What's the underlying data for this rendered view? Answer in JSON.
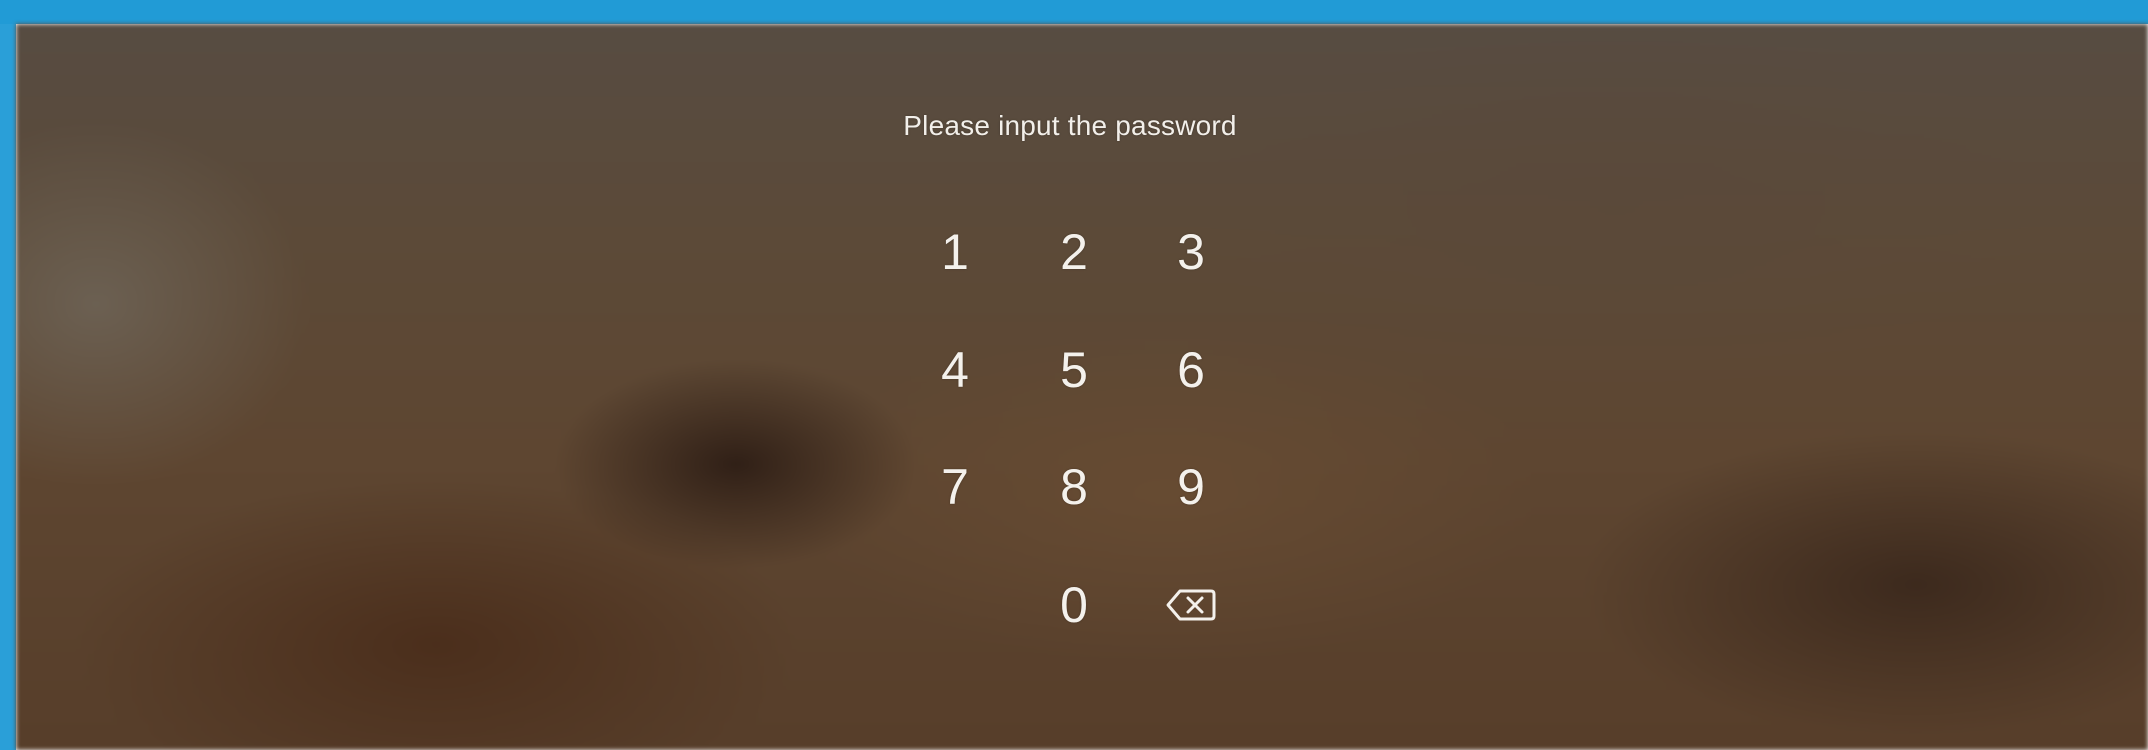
{
  "colors": {
    "top_bar": "#219bd6",
    "text": "#f4f1ec"
  },
  "lock_screen": {
    "prompt": "Please input the password",
    "keys": [
      "1",
      "2",
      "3",
      "4",
      "5",
      "6",
      "7",
      "8",
      "9",
      "0"
    ],
    "delete_icon": "backspace-icon"
  }
}
